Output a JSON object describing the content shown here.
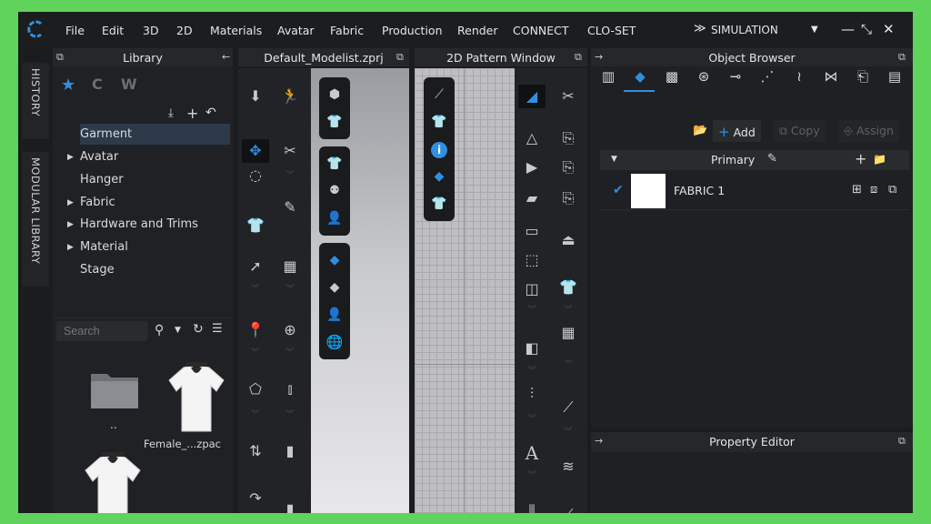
{
  "menu": {
    "items": [
      "File",
      "Edit",
      "3D",
      "2D",
      "Materials",
      "Avatar",
      "Fabric",
      "Production",
      "Render",
      "CONNECT",
      "CLO-SET"
    ],
    "simulation_label": "SIMULATION",
    "window_controls": [
      "minimize",
      "restore",
      "close"
    ]
  },
  "side_tabs": {
    "history": "HISTORY",
    "modular_library": "MODULAR LIBRARY"
  },
  "library": {
    "title": "Library",
    "tree": [
      {
        "label": "Garment",
        "expandable": false,
        "selected": true
      },
      {
        "label": "Avatar",
        "expandable": true
      },
      {
        "label": "Hanger",
        "expandable": false
      },
      {
        "label": "Fabric",
        "expandable": true
      },
      {
        "label": "Hardware and Trims",
        "expandable": true
      },
      {
        "label": "Material",
        "expandable": true
      },
      {
        "label": "Stage",
        "expandable": false
      }
    ],
    "search_placeholder": "Search",
    "items": [
      {
        "label": "..",
        "icon": "folder-icon"
      },
      {
        "label": "Female_...zpac",
        "icon": "tshirt-icon"
      },
      {
        "label": "",
        "icon": "tshirt-icon"
      }
    ]
  },
  "viewport3d": {
    "title": "Default_Modelist.zprj"
  },
  "pattern2d": {
    "title": "2D Pattern Window"
  },
  "object_browser": {
    "title": "Object Browser",
    "add_label": "Add",
    "copy_label": "Copy",
    "assign_label": "Assign",
    "group_label": "Primary",
    "fabrics": [
      {
        "name": "FABRIC 1",
        "checked": true,
        "color": "#ffffff"
      }
    ]
  },
  "property_editor": {
    "title": "Property Editor"
  },
  "colors": {
    "accent": "#2f8fe0",
    "background": "#1b1c1e",
    "frame": "#5fd35b"
  }
}
